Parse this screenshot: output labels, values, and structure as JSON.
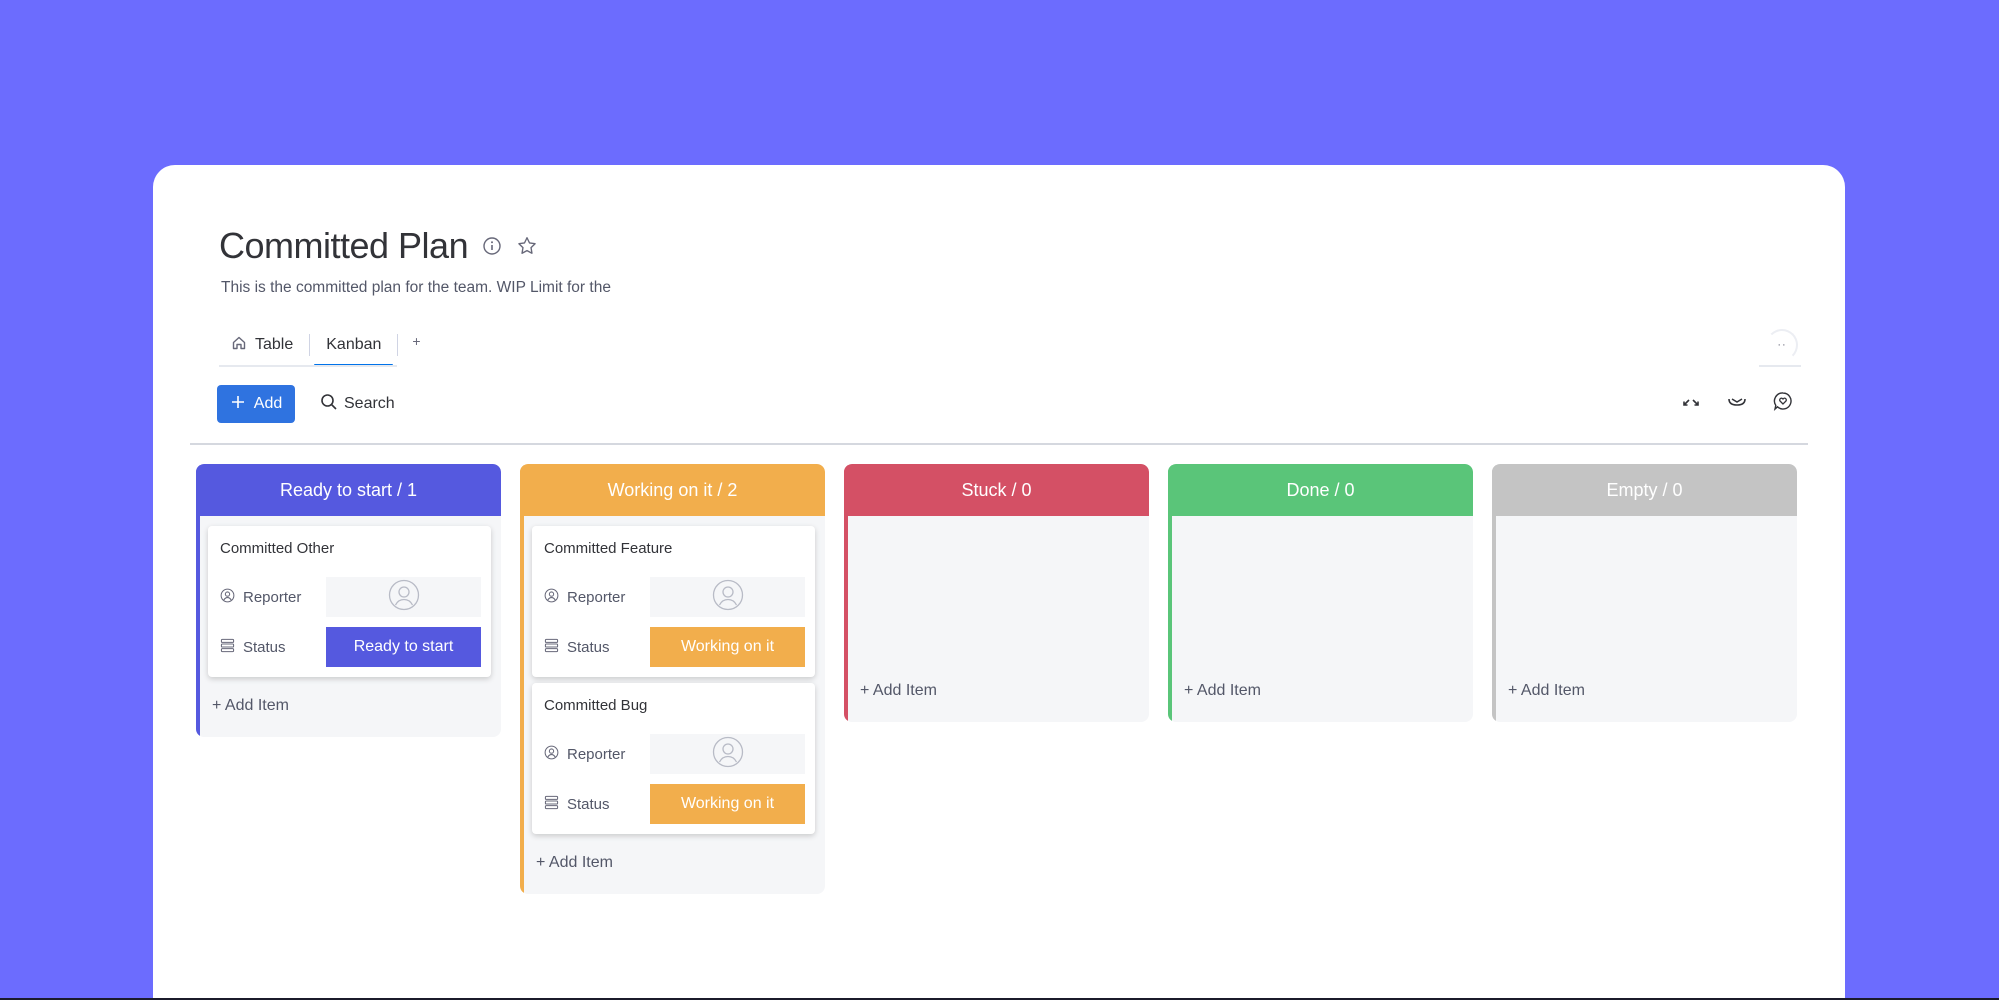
{
  "header": {
    "title": "Committed Plan",
    "description": "This is the committed plan for the team. WIP Limit for the",
    "info_icon": "info-circle-icon",
    "star_icon": "star-outline-icon"
  },
  "tabs": [
    {
      "label": "Table",
      "icon": "home-icon",
      "active": false
    },
    {
      "label": "Kanban",
      "active": true
    }
  ],
  "tab_add_label": "+",
  "more_label": "··",
  "toolbar": {
    "add_label": "Add",
    "search_label": "Search",
    "icons": [
      "collapse-arrows-icon",
      "integrations-icon",
      "feedback-heart-icon"
    ]
  },
  "colors": {
    "background": "#6c6cfe",
    "ready": "#5559df",
    "working": "#f2ae4c",
    "stuck": "#d45065",
    "done": "#5ac579",
    "empty": "#c4c4c4",
    "primary": "#2f73e0"
  },
  "columns": [
    {
      "title": "Ready to start / 1",
      "add_item": "+ Add Item",
      "cards": [
        {
          "title": "Committed Other",
          "reporter_label": "Reporter",
          "status_label": "Status",
          "status": "Ready to start"
        }
      ]
    },
    {
      "title": "Working on it / 2",
      "add_item": "+ Add Item",
      "cards": [
        {
          "title": "Committed Feature",
          "reporter_label": "Reporter",
          "status_label": "Status",
          "status": "Working on it"
        },
        {
          "title": "Committed Bug",
          "reporter_label": "Reporter",
          "status_label": "Status",
          "status": "Working on it"
        }
      ]
    },
    {
      "title": "Stuck / 0",
      "add_item": "+ Add Item",
      "cards": []
    },
    {
      "title": "Done / 0",
      "add_item": "+ Add Item",
      "cards": []
    },
    {
      "title": "Empty / 0",
      "add_item": "+ Add Item",
      "cards": []
    }
  ]
}
